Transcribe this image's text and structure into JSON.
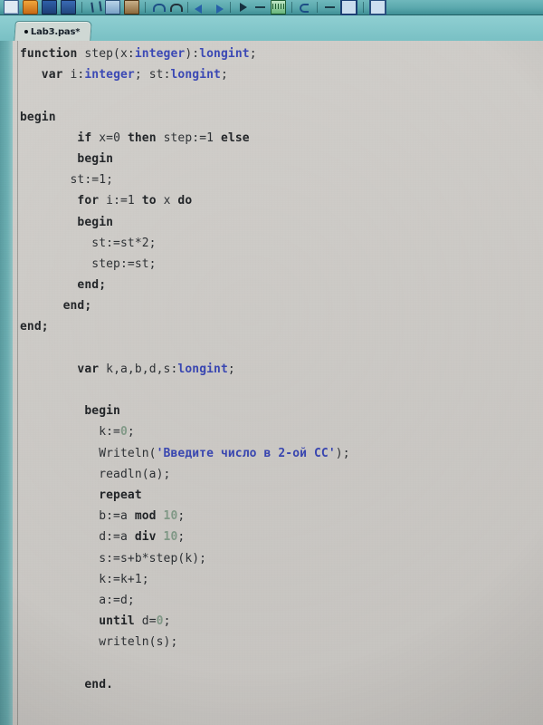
{
  "window": {
    "background_color": "#d2cfcb",
    "toolbar_color": "#5aa8ad",
    "accent_color": "#2b3ab4"
  },
  "toolbar": {
    "items": [
      {
        "name": "new-file-icon",
        "class": "ic-doc"
      },
      {
        "name": "open-folder-icon",
        "class": "ic-folder"
      },
      {
        "name": "save-icon",
        "class": "ic-save"
      },
      {
        "name": "save-all-icon",
        "class": "ic-saveall"
      },
      {
        "name": "separator",
        "class": "sep"
      },
      {
        "name": "cut-scissors-icon",
        "class": "ic-scissor"
      },
      {
        "name": "copy-icon",
        "class": "ic-copy"
      },
      {
        "name": "paste-icon",
        "class": "ic-paste"
      },
      {
        "name": "separator",
        "class": "sep"
      },
      {
        "name": "undo-icon",
        "class": "ic-undo"
      },
      {
        "name": "redo-icon",
        "class": "ic-redo"
      },
      {
        "name": "separator",
        "class": "sep"
      },
      {
        "name": "navigate-back-icon",
        "class": "ic-blue-arrow"
      },
      {
        "name": "navigate-forward-icon",
        "class": "ic-blue-arrow2"
      },
      {
        "name": "separator",
        "class": "sep"
      },
      {
        "name": "run-icon",
        "class": "ic-run"
      },
      {
        "name": "pause-icon",
        "class": "ic-dash"
      },
      {
        "name": "stop-icon",
        "class": "ic-keys"
      },
      {
        "name": "separator",
        "class": "sep"
      },
      {
        "name": "step-over-icon",
        "class": "ic-step"
      },
      {
        "name": "separator",
        "class": "sep"
      },
      {
        "name": "step-into-icon",
        "class": "ic-dash"
      },
      {
        "name": "toggle-form-icon",
        "class": "ic-window"
      },
      {
        "name": "separator",
        "class": "sep"
      },
      {
        "name": "toggle-unit-icon",
        "class": "ic-window2"
      }
    ]
  },
  "tab": {
    "label": "Lab3.pas*",
    "modified_marker": "•",
    "active": true
  },
  "editor": {
    "language": "pascal",
    "code_lines": [
      [
        {
          "t": "function ",
          "c": "kw"
        },
        {
          "t": "step(x:",
          "c": "id"
        },
        {
          "t": "integer",
          "c": "typ"
        },
        {
          "t": "):",
          "c": "id"
        },
        {
          "t": "longint",
          "c": "typ"
        },
        {
          "t": ";",
          "c": "id"
        }
      ],
      [
        {
          "t": "   ",
          "c": "id"
        },
        {
          "t": "var ",
          "c": "kw"
        },
        {
          "t": "i:",
          "c": "id"
        },
        {
          "t": "integer",
          "c": "typ"
        },
        {
          "t": "; st:",
          "c": "id"
        },
        {
          "t": "longint",
          "c": "typ"
        },
        {
          "t": ";",
          "c": "id"
        }
      ],
      [
        {
          "t": "",
          "c": "id"
        }
      ],
      [
        {
          "t": "begin",
          "c": "kw"
        }
      ],
      [
        {
          "t": "        ",
          "c": "id"
        },
        {
          "t": "if ",
          "c": "kw"
        },
        {
          "t": "x=",
          "c": "id"
        },
        {
          "t": "0",
          "c": "id"
        },
        {
          "t": " ",
          "c": "id"
        },
        {
          "t": "then ",
          "c": "kw"
        },
        {
          "t": "step:=",
          "c": "id"
        },
        {
          "t": "1",
          "c": "id"
        },
        {
          "t": " ",
          "c": "id"
        },
        {
          "t": "else",
          "c": "kw"
        }
      ],
      [
        {
          "t": "        ",
          "c": "id"
        },
        {
          "t": "begin",
          "c": "kw"
        }
      ],
      [
        {
          "t": "       st:=1;",
          "c": "id"
        }
      ],
      [
        {
          "t": "        ",
          "c": "id"
        },
        {
          "t": "for ",
          "c": "kw"
        },
        {
          "t": "i:=1 ",
          "c": "id"
        },
        {
          "t": "to ",
          "c": "kw"
        },
        {
          "t": "x ",
          "c": "id"
        },
        {
          "t": "do",
          "c": "kw"
        }
      ],
      [
        {
          "t": "        ",
          "c": "id"
        },
        {
          "t": "begin",
          "c": "kw"
        }
      ],
      [
        {
          "t": "          st:=st*2;",
          "c": "id"
        }
      ],
      [
        {
          "t": "          step:=st;",
          "c": "id"
        }
      ],
      [
        {
          "t": "        ",
          "c": "id"
        },
        {
          "t": "end;",
          "c": "kw"
        }
      ],
      [
        {
          "t": "      ",
          "c": "id"
        },
        {
          "t": "end;",
          "c": "kw"
        }
      ],
      [
        {
          "t": "end;",
          "c": "kw"
        }
      ],
      [
        {
          "t": "",
          "c": "id"
        }
      ],
      [
        {
          "t": "        ",
          "c": "id"
        },
        {
          "t": "var ",
          "c": "kw"
        },
        {
          "t": "k,a,b,d,s:",
          "c": "id"
        },
        {
          "t": "longint",
          "c": "typ"
        },
        {
          "t": ";",
          "c": "id"
        }
      ],
      [
        {
          "t": "",
          "c": "id"
        }
      ],
      [
        {
          "t": "         ",
          "c": "id"
        },
        {
          "t": "begin",
          "c": "kw"
        }
      ],
      [
        {
          "t": "           k:=",
          "c": "id"
        },
        {
          "t": "0",
          "c": "num"
        },
        {
          "t": ";",
          "c": "id"
        }
      ],
      [
        {
          "t": "           Writeln(",
          "c": "id"
        },
        {
          "t": "'Введите число в 2-ой СС'",
          "c": "str"
        },
        {
          "t": ");",
          "c": "id"
        }
      ],
      [
        {
          "t": "           readln(a);",
          "c": "id"
        }
      ],
      [
        {
          "t": "           ",
          "c": "id"
        },
        {
          "t": "repeat",
          "c": "kw"
        }
      ],
      [
        {
          "t": "           b:=a ",
          "c": "id"
        },
        {
          "t": "mod ",
          "c": "kw"
        },
        {
          "t": "10",
          "c": "num"
        },
        {
          "t": ";",
          "c": "id"
        }
      ],
      [
        {
          "t": "           d:=a ",
          "c": "id"
        },
        {
          "t": "div ",
          "c": "kw"
        },
        {
          "t": "10",
          "c": "num"
        },
        {
          "t": ";",
          "c": "id"
        }
      ],
      [
        {
          "t": "           s:=s+b*step(k);",
          "c": "id"
        }
      ],
      [
        {
          "t": "           k:=k+1;",
          "c": "id"
        }
      ],
      [
        {
          "t": "           a:=d;",
          "c": "id"
        }
      ],
      [
        {
          "t": "           ",
          "c": "id"
        },
        {
          "t": "until ",
          "c": "kw"
        },
        {
          "t": "d=",
          "c": "id"
        },
        {
          "t": "0",
          "c": "num"
        },
        {
          "t": ";",
          "c": "id"
        }
      ],
      [
        {
          "t": "           writeln(s);",
          "c": "id"
        }
      ],
      [
        {
          "t": "",
          "c": "id"
        }
      ],
      [
        {
          "t": "         ",
          "c": "id"
        },
        {
          "t": "end.",
          "c": "kw"
        }
      ]
    ]
  }
}
